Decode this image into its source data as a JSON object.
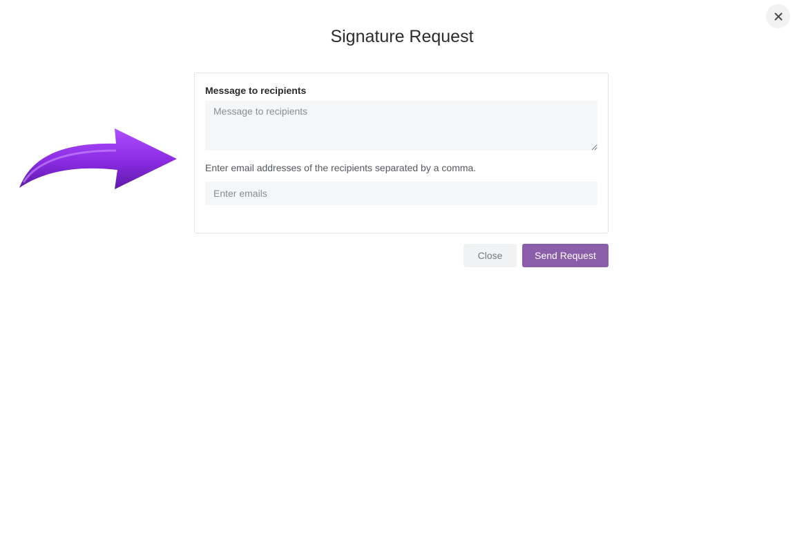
{
  "dialog": {
    "title": "Signature Request",
    "close_icon": "close-icon"
  },
  "decoration": {
    "arrow_icon": "curved-arrow-right-icon",
    "arrow_color": "#8a2be2"
  },
  "form": {
    "message_label": "Message to recipients",
    "message_placeholder": "Message to recipients",
    "message_value": "",
    "emails_hint": "Enter email addresses of the recipients separated by a comma.",
    "emails_placeholder": "Enter emails",
    "emails_value": ""
  },
  "actions": {
    "close_label": "Close",
    "send_label": "Send Request",
    "send_color": "#8a5ea8"
  }
}
